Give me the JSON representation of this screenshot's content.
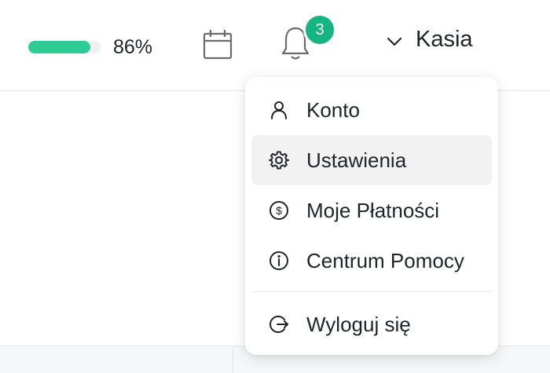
{
  "header": {
    "progress_percent": 86,
    "progress_label": "86%",
    "calendar_icon": "calendar-icon",
    "bell_icon": "bell-icon",
    "notification_count": "3",
    "user_name": "Kasia",
    "accent_color": "#2ecc94",
    "badge_color": "#16b57f"
  },
  "menu": {
    "items": [
      {
        "label": "Konto",
        "icon": "user-icon"
      },
      {
        "label": "Ustawienia",
        "icon": "gear-icon",
        "active": true
      },
      {
        "label": "Moje Płatności",
        "icon": "dollar-circle-icon"
      },
      {
        "label": "Centrum Pomocy",
        "icon": "info-circle-icon"
      }
    ],
    "logout": {
      "label": "Wyloguj się",
      "icon": "logout-icon"
    }
  }
}
